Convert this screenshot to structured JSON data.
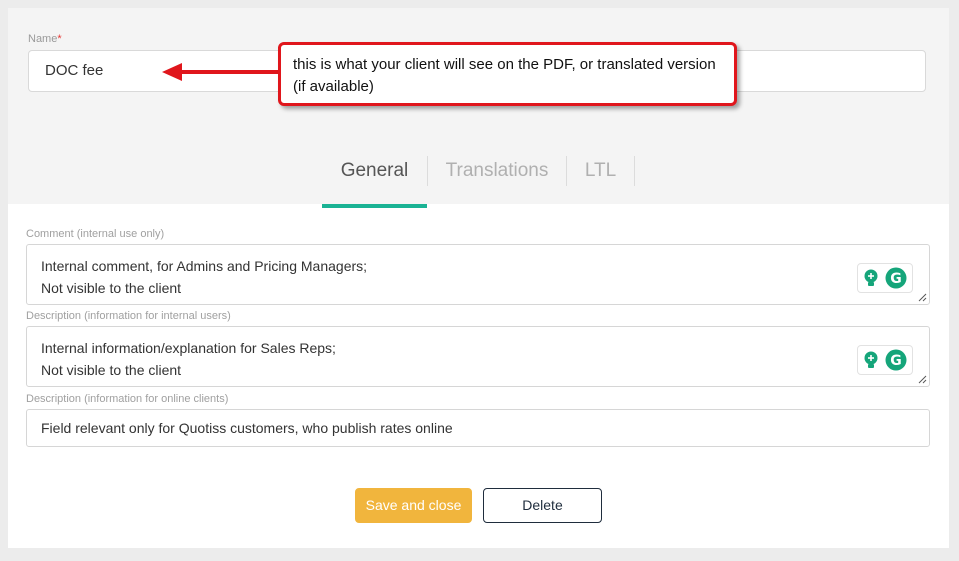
{
  "name_field": {
    "label": "Name",
    "required_mark": "*",
    "value": "DOC fee"
  },
  "callout": {
    "text": "this is what your client will see on the PDF, or translated version (if available)",
    "border_color": "#e0161c"
  },
  "tabs": [
    {
      "label": "General",
      "active": true
    },
    {
      "label": "Translations",
      "active": false
    },
    {
      "label": "LTL",
      "active": false
    }
  ],
  "comment": {
    "label": "Comment (internal use only)",
    "line1": "Internal comment, for Admins and Pricing Managers;",
    "line2": "Not visible to the client"
  },
  "description_internal": {
    "label": "Description (information for internal users)",
    "line1": "Internal information/explanation for Sales Reps;",
    "line2": "Not visible to the client"
  },
  "description_online": {
    "label": "Description (information for online clients)",
    "value": "Field relevant only for Quotiss customers, who publish rates online"
  },
  "buttons": {
    "save_label": "Save and close",
    "delete_label": "Delete"
  },
  "colors": {
    "accent_tab": "#1ab394",
    "save_button": "#f1b53d",
    "grammarly": "#15a57a"
  },
  "icons": [
    "arrow-left-icon",
    "lightbulb-icon",
    "grammarly-icon",
    "resize-handle-icon"
  ]
}
